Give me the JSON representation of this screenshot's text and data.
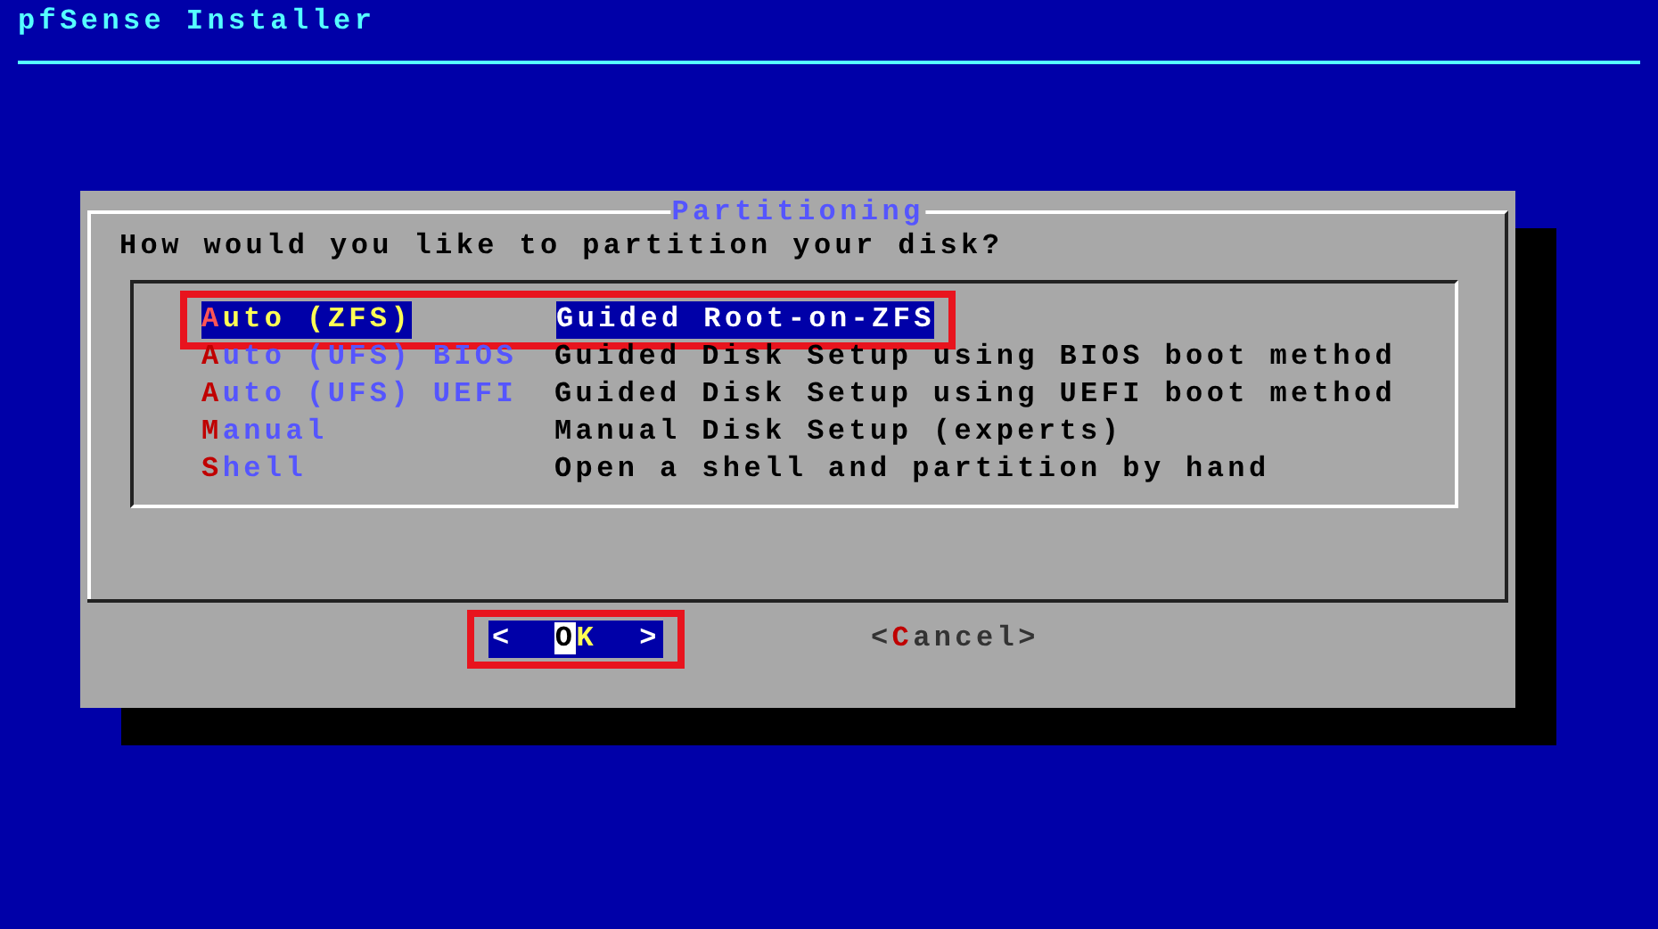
{
  "window": {
    "title": "pfSense Installer"
  },
  "dialog": {
    "title": "Partitioning",
    "prompt": "How would you like to partition your disk?",
    "items": [
      {
        "label": "Auto (ZFS)",
        "description": "Guided Root-on-ZFS",
        "selected": true,
        "annotated": true
      },
      {
        "label": "Auto (UFS) BIOS",
        "description": "Guided Disk Setup using BIOS boot method",
        "selected": false,
        "annotated": false
      },
      {
        "label": "Auto (UFS) UEFI",
        "description": "Guided Disk Setup using UEFI boot method",
        "selected": false,
        "annotated": false
      },
      {
        "label": "Manual",
        "description": "Manual Disk Setup (experts)",
        "selected": false,
        "annotated": false
      },
      {
        "label": "Shell",
        "description": "Open a shell and partition by hand",
        "selected": false,
        "annotated": false
      }
    ],
    "buttons": [
      {
        "label": "<  OK  >",
        "selected": true,
        "annotated": true
      },
      {
        "label": "<Cancel>",
        "selected": false,
        "annotated": false
      }
    ]
  }
}
